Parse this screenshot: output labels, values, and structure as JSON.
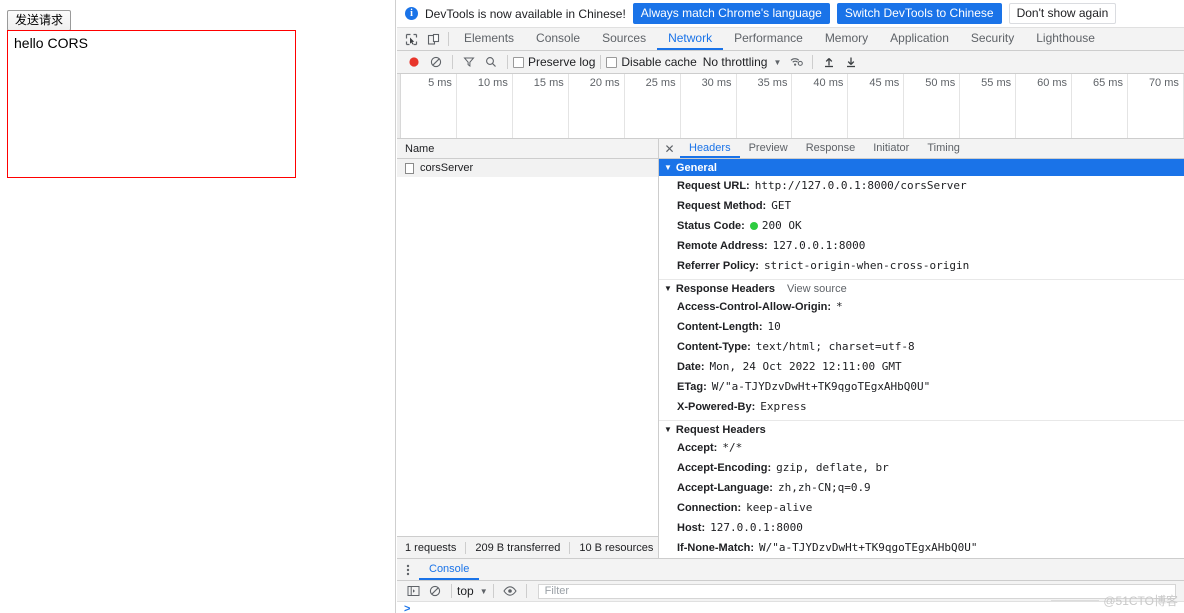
{
  "page": {
    "send_button": "发送请求",
    "result_text": "hello CORS",
    "result_border_color": "#ff0000"
  },
  "devtools": {
    "locale_banner": {
      "icon": "info-icon",
      "message": "DevTools is now available in Chinese!",
      "primary_button": "Always match Chrome's language",
      "secondary_button": "Switch DevTools to Chinese",
      "dismiss_button": "Don't show again",
      "accent_color": "#1a73e8"
    },
    "tabs": [
      {
        "label": "Elements",
        "active": false
      },
      {
        "label": "Console",
        "active": false
      },
      {
        "label": "Sources",
        "active": false
      },
      {
        "label": "Network",
        "active": true
      },
      {
        "label": "Performance",
        "active": false
      },
      {
        "label": "Memory",
        "active": false
      },
      {
        "label": "Application",
        "active": false
      },
      {
        "label": "Security",
        "active": false
      },
      {
        "label": "Lighthouse",
        "active": false
      }
    ],
    "network_toolbar": {
      "record_label": "record-button",
      "clear_label": "clear-button",
      "filter_label": "filter-button",
      "search_label": "search-button",
      "preserve_log": "Preserve log",
      "preserve_log_checked": false,
      "disable_cache": "Disable cache",
      "disable_cache_checked": false,
      "throttling": "No throttling",
      "import_label": "import-har-button",
      "export_label": "export-har-button"
    },
    "timeline": {
      "ticks": [
        "5 ms",
        "10 ms",
        "15 ms",
        "20 ms",
        "25 ms",
        "30 ms",
        "35 ms",
        "40 ms",
        "45 ms",
        "50 ms",
        "55 ms",
        "60 ms",
        "65 ms",
        "70 ms"
      ]
    },
    "request_list": {
      "column_header": "Name",
      "rows": [
        {
          "name": "corsServer",
          "selected": true
        }
      ],
      "status": {
        "requests": "1 requests",
        "transferred": "209 B transferred",
        "resources": "10 B resources"
      }
    },
    "detail_tabs": [
      {
        "label": "Headers",
        "active": true
      },
      {
        "label": "Preview",
        "active": false
      },
      {
        "label": "Response",
        "active": false
      },
      {
        "label": "Initiator",
        "active": false
      },
      {
        "label": "Timing",
        "active": false
      }
    ],
    "sections": [
      {
        "title": "General",
        "selected": true,
        "view_source": "",
        "rows": [
          {
            "key": "Request URL:",
            "value": "http://127.0.0.1:8000/corsServer"
          },
          {
            "key": "Request Method:",
            "value": "GET"
          },
          {
            "key": "Status Code:",
            "value": "200 OK",
            "status_dot": true
          },
          {
            "key": "Remote Address:",
            "value": "127.0.0.1:8000"
          },
          {
            "key": "Referrer Policy:",
            "value": "strict-origin-when-cross-origin"
          }
        ]
      },
      {
        "title": "Response Headers",
        "selected": false,
        "view_source": "View source",
        "rows": [
          {
            "key": "Access-Control-Allow-Origin:",
            "value": "*"
          },
          {
            "key": "Content-Length:",
            "value": "10"
          },
          {
            "key": "Content-Type:",
            "value": "text/html; charset=utf-8"
          },
          {
            "key": "Date:",
            "value": "Mon, 24 Oct 2022 12:11:00 GMT"
          },
          {
            "key": "ETag:",
            "value": "W/\"a-TJYDzvDwHt+TK9qgoTEgxAHbQ0U\""
          },
          {
            "key": "X-Powered-By:",
            "value": "Express"
          }
        ]
      },
      {
        "title": "Request Headers",
        "selected": false,
        "view_source": "",
        "rows": [
          {
            "key": "Accept:",
            "value": "*/*"
          },
          {
            "key": "Accept-Encoding:",
            "value": "gzip, deflate, br"
          },
          {
            "key": "Accept-Language:",
            "value": "zh,zh-CN;q=0.9"
          },
          {
            "key": "Connection:",
            "value": "keep-alive"
          },
          {
            "key": "Host:",
            "value": "127.0.0.1:8000"
          },
          {
            "key": "If-None-Match:",
            "value": "W/\"a-TJYDzvDwHt+TK9qgoTEgxAHbQ0U\""
          }
        ]
      }
    ],
    "drawer": {
      "tab": "Console",
      "context": "top",
      "filter_placeholder": "Filter",
      "prompt": ">"
    }
  },
  "watermark": "@51CTO博客"
}
